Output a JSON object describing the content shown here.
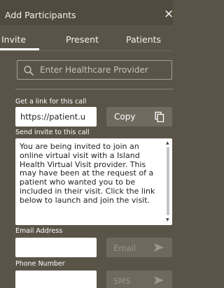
{
  "header": {
    "title": "Add Participants",
    "close_label": "×"
  },
  "tabs": [
    {
      "label": "Invite",
      "selected": true
    },
    {
      "label": "Present",
      "selected": false
    },
    {
      "label": "Patients",
      "selected": false
    }
  ],
  "search": {
    "placeholder": "Enter Healthcare Provider",
    "icon": "search-icon"
  },
  "get_link": {
    "label": "Get a link for this call",
    "link_value": "https://patient.u",
    "copy_label": "Copy",
    "copy_icon": "copy-icon"
  },
  "send_invite": {
    "label": "Send invite to this call",
    "message": "You are being invited to join an online virtual visit with a Island Health Virtual Visit provider. This may have been at the request of a patient who wanted you to be included in their visit. Click the link below to launch and join the visit."
  },
  "email": {
    "label": "Email Address",
    "value": "",
    "button_label": "Email",
    "button_icon": "send-arrow-icon"
  },
  "phone": {
    "label": "Phone Number",
    "value": "",
    "button_label": "SMS",
    "button_icon": "send-arrow-icon"
  },
  "colors": {
    "panel_bg": "#5a5448",
    "header_bg": "#504a3f",
    "button_bg": "#706a5f",
    "disabled_text": "#9b958a"
  }
}
